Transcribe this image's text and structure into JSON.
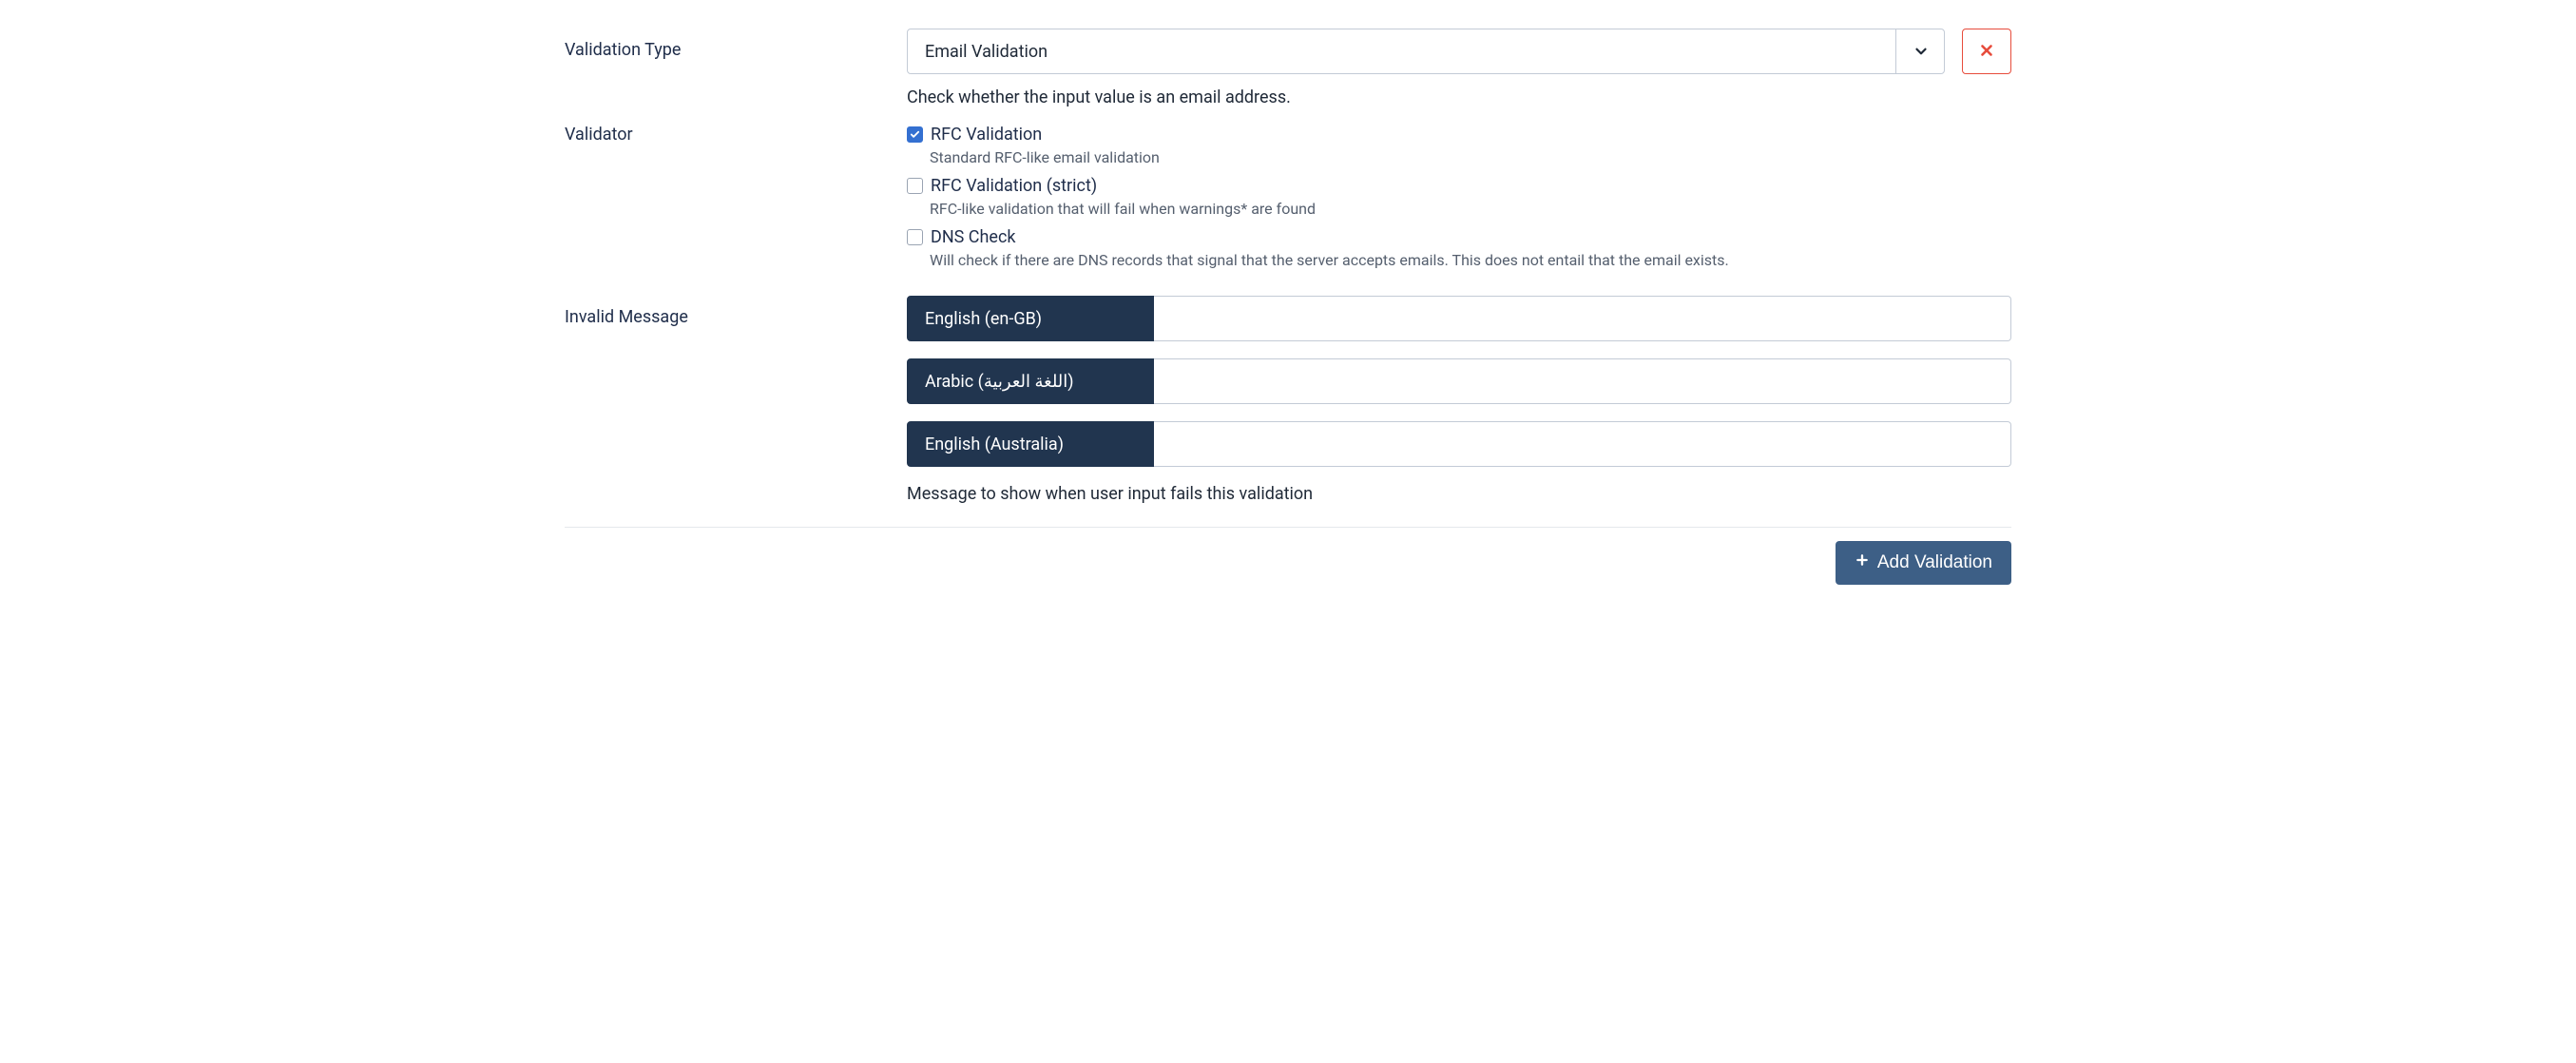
{
  "labels": {
    "validation_type": "Validation Type",
    "validator": "Validator",
    "invalid_message": "Invalid Message"
  },
  "validation_type": {
    "selected": "Email Validation",
    "help": "Check whether the input value is an email address."
  },
  "validators": [
    {
      "key": "rfc",
      "label": "RFC Validation",
      "help": "Standard RFC-like email validation",
      "checked": true
    },
    {
      "key": "rfc-strict",
      "label": "RFC Validation (strict)",
      "help": "RFC-like validation that will fail when warnings* are found",
      "checked": false
    },
    {
      "key": "dns",
      "label": "DNS Check",
      "help": "Will check if there are DNS records that signal that the server accepts emails. This does not entail that the email exists.",
      "checked": false
    }
  ],
  "invalid_messages": [
    {
      "lang": "English (en-GB)",
      "value": ""
    },
    {
      "lang": "Arabic (اللغة العربية)",
      "value": ""
    },
    {
      "lang": "English (Australia)",
      "value": ""
    }
  ],
  "invalid_message_help": "Message to show when user input fails this validation",
  "add_button_label": "Add Validation"
}
